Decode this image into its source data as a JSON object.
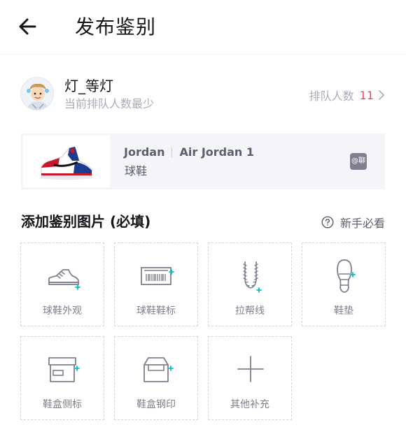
{
  "header": {
    "title": "发布鉴别"
  },
  "appraiser": {
    "name": "灯_等灯",
    "subtitle": "当前排队人数最少",
    "queue_label": "排队人数",
    "queue_count": "11"
  },
  "product": {
    "brand": "Jordan",
    "series": "Air Jordan 1",
    "category": "球鞋",
    "chat_label": "@聊"
  },
  "section": {
    "title": "添加鉴别图片 (必填)",
    "guide_label": "新手必看"
  },
  "photo_slots": [
    {
      "label": "球鞋外观",
      "icon": "sneaker-icon"
    },
    {
      "label": "球鞋鞋标",
      "icon": "barcode-label-icon"
    },
    {
      "label": "拉帮线",
      "icon": "stitching-icon"
    },
    {
      "label": "鞋垫",
      "icon": "insole-icon"
    },
    {
      "label": "鞋盒侧标",
      "icon": "shoebox-side-label-icon"
    },
    {
      "label": "鞋盒钢印",
      "icon": "shoebox-stamp-icon"
    },
    {
      "label": "其他补充",
      "icon": "add-icon"
    }
  ],
  "colors": {
    "accent": "#01c2c3",
    "count_red": "#ff4657",
    "muted_text": "#aaaabb",
    "icon_gray": "#7f7f8e"
  }
}
